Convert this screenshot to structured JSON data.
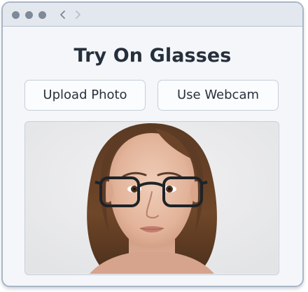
{
  "app": {
    "title": "Try On Glasses"
  },
  "titlebar": {
    "back_icon": "chevron-left-icon",
    "forward_icon": "chevron-right-icon"
  },
  "actions": {
    "upload_label": "Upload Photo",
    "webcam_label": "Use Webcam"
  },
  "preview": {
    "image_alt": "woman-wearing-glasses-portrait"
  },
  "colors": {
    "window_border": "#a9b6c6",
    "titlebar_bg": "#e3e8ef",
    "window_bg": "#f4f6fa",
    "text": "#26303c"
  }
}
